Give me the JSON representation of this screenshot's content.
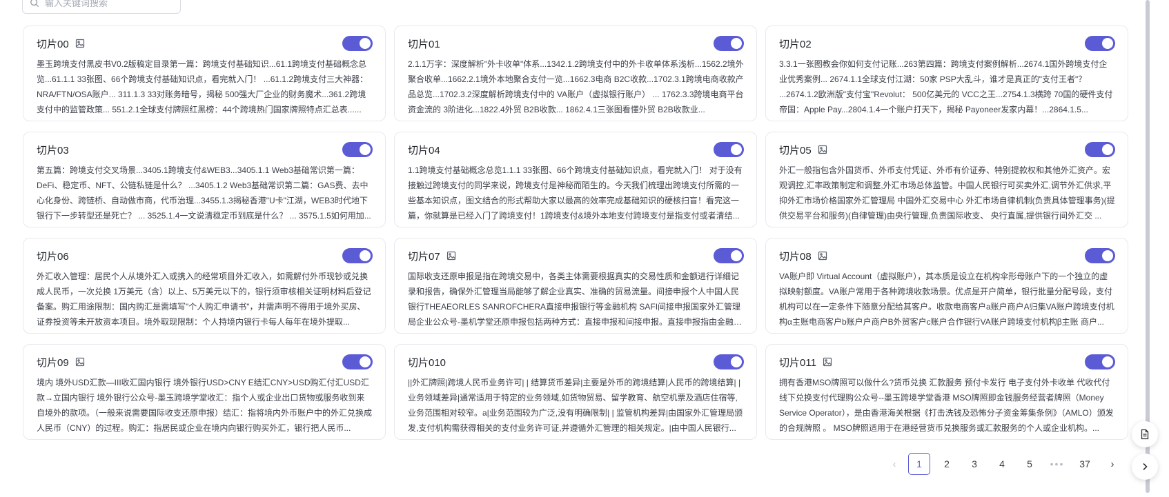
{
  "search": {
    "placeholder": "输入关键词搜索"
  },
  "cards": [
    {
      "title": "切片00",
      "has_image": true,
      "enabled": true,
      "content": "墨玉跨境支付黑皮书V0.2版稿定目录第一篇：跨境支付基础知识...61.1跨境支付基础概念总览...61.1.1 33张图、66个跨境支付基础知识点，看完就入门！ ...61.1.2跨境支付三大神器：NRA/FTN/OSA账户... 311.1.3 33对账务暗号，揭秘 500强大厂企业的财务魔术...361.2跨境支付中的监管政策... 551.2.1全球支付牌照红黑榜：44个跨境热门国家牌照特点汇总表......"
    },
    {
      "title": "切片01",
      "has_image": false,
      "enabled": true,
      "content": "2.1.1万字：深度解析\"外卡收单\"体系...1342.1.2跨境支付中的外卡收单体系浅析...1562.2境外聚合收单...1662.2.1境外本地聚合支付一览...1662.3电商 B2C收款...1702.3.1跨境电商收款产品总览...1702.3.2深度解析跨境支付中的 VA账户（虚拟银行账户） ... 1762.3.3跨境电商平台资金流的 3阶进化...1822.4外贸 B2B收款... 1862.4.1三张图看懂外贸 B2B收款业..."
    },
    {
      "title": "切片02",
      "has_image": false,
      "enabled": true,
      "content": "3.3.1一张图教会你如何支付记账...263第四篇：跨境支付案例解析...2674.1国外跨境支付企业优秀案例... 2674.1.1全球支付江湖：50家 PSP大乱斗，谁才是真正的\"支付王者\"？ ...2674.1.2欧洲版\"支付宝\"Revolut： 500亿美元的 VCC之王...2754.1.3横跨 70国的硬件支付帝国：Apple Pay...2804.1.4一个账户打天下，揭秘 Payoneer发家内幕！...2864.1.5..."
    },
    {
      "title": "切片03",
      "has_image": false,
      "enabled": true,
      "content": "第五篇：跨境支付交叉场景...3405.1跨境支付&WEB3...3405.1.1 Web3基础常识第一篇：DeFi、稳定币、NFT、公链私链是什么？ ...3405.1.2 Web3基础常识第二篇：GAS费、去中心化身份、跨链桥、自动做市商，代币治理...3455.1.3揭秘香港\"U卡\"江湖，WEB3时代地下银行下一步转型还是死亡？ ... 3525.1.4一文说清稳定币到底是什么？ ... 3575.1.5如何用加..."
    },
    {
      "title": "切片04",
      "has_image": false,
      "enabled": true,
      "content": "1.1跨境支付基础概念总览1.1.1 33张图、66个跨境支付基础知识点，看完就入门！ 对于没有接触过跨境支付的同学来说，跨境支付是神秘而陌生的。今天我们梳理出跨境支付所需的一些基本知识点，图文结合的形式帮助大家以最高的效率完成基础知识的硬核扫盲！看完这一篇，你就算是已经入门了跨境支付！1跨境支付&境外本地支付跨境支付是指支付或者清结..."
    },
    {
      "title": "切片05",
      "has_image": true,
      "enabled": true,
      "content": "外汇一般指包含外国货币、外币支付凭证、外币有价证券、特别提款权和其他外汇资产。宏观调控,汇率政策制定和调整,外汇市场总体监管。中国人民银行可买卖外汇,调节外汇供求,平抑外汇市场价格国家外汇管理局 中国外汇交易中心 外汇市场自律机制(负责具体管理事务)(提供交易平台和服务)(自律管理)由央行管理,负责国际收支、 央行直属,提供银行间外汇交 ..."
    },
    {
      "title": "切片06",
      "has_image": false,
      "enabled": true,
      "content": "外汇收入管理：居民个人从境外汇入或携入的经常项目外汇收入，如需解付外币现钞或兑换成人民币，一次兑换 1万美元（含）以上、5万美元以下的，银行须审核相关证明材料后登记备案。购汇用途限制：国内购汇是需填写\"个人购汇申请书\"，并需声明不得用于境外买房、证券投资等未开放资本项目。境外取现限制：个人持境内银行卡每人每年在境外提取..."
    },
    {
      "title": "切片07",
      "has_image": true,
      "enabled": true,
      "content": "国际收支还原申报是指在跨境交易中，各类主体需要根据真实的交易性质和金额进行详细记录和报告，确保外汇管理当局能够了解企业真实、准确的贸易流量。间接申报个人中国人民银行THEAEORLES SANROFCHERA直接申报银行等金融机构 SAFI间接申报国家外汇管理局企业公众号-墨机学堂还原申报包括两种方式：直接申报和间接申报。直接申报指由金融机..."
    },
    {
      "title": "切片08",
      "has_image": true,
      "enabled": true,
      "content": "VA账户即 Virtual Account（虚拟账户），其本质是设立在机构伞形母账户下的一个独立的虚拟映射额度。VA账户常用于各种跨境收款场景。优点是开户简单，银行批量分配号段，支付机构可以在一定条件下随意分配给其客户。收款电商客户a账户商户A归集VA账户跨境支付机构α主账电商客户b账户户商户B外贸客户c账户合作银行VA账户跨境支付机构β主账 商户..."
    },
    {
      "title": "切片09",
      "has_image": true,
      "enabled": true,
      "content": "境内 境外USD汇款—III收汇国内银行 境外银行USD>CNY E结汇CNY>USD购汇付汇USD汇款→立国内银行 境外银行公众号-墨玉跨境学堂收汇：指个人或企业出口货物或服务收到来自境外的款项。（一般来说需要国际收支还原申报）结汇：指将境内外币账户中的外汇兑换成人民币（CNY）的过程。购汇：指居民或企业在境内向银行购买外汇，银行把人民币..."
    },
    {
      "title": "切片010",
      "has_image": false,
      "enabled": true,
      "content": "||外汇牌照|跨境人民币业务许可| | 结算货币差异|主要是外币的跨境结算|人民币的跨境结算| | 业务领域差异|通常适用于特定的业务领域,如货物贸易、留学教育、航空机票及酒店住宿等,业务范围相对较窄。a|业务范围较为广泛,没有明确限制| | 监管机构差异|由国家外汇管理局颁发,支付机构需获得相关的支付业务许可证,并遵循外汇管理的相关规定。|由中国人民银行..."
    },
    {
      "title": "切片011",
      "has_image": true,
      "enabled": true,
      "content": "拥有香港MSO牌照可以做什么?货币兑换 汇款服务 预付卡发行 电子支付外卡收单 代收代付线下兑换支付代理购公众号--墨玉跨境学堂香港 MSO牌照即金钱服务经营者牌照（Money Service Operator），是由香港海关根据《打击洗钱及恐怖分子资金筹集条例》（AMLO）颁发的合规牌照 。 MSO牌照适用于在港经营货币兑换服务或汇款服务的个人或企业机构。..."
    }
  ],
  "pagination": {
    "prev_symbol": "‹",
    "next_symbol": "›",
    "pages": [
      "1",
      "2",
      "3",
      "4",
      "5"
    ],
    "current": "1",
    "ellipsis": "•••",
    "last_page": "37"
  },
  "colors": {
    "accent": "#5b5bd6",
    "border": "#e8e9ee",
    "text": "#3c4049"
  },
  "icons": {
    "search": "search-icon",
    "image": "image-icon",
    "document": "document-icon",
    "chevron_right": "chevron-right-icon"
  }
}
